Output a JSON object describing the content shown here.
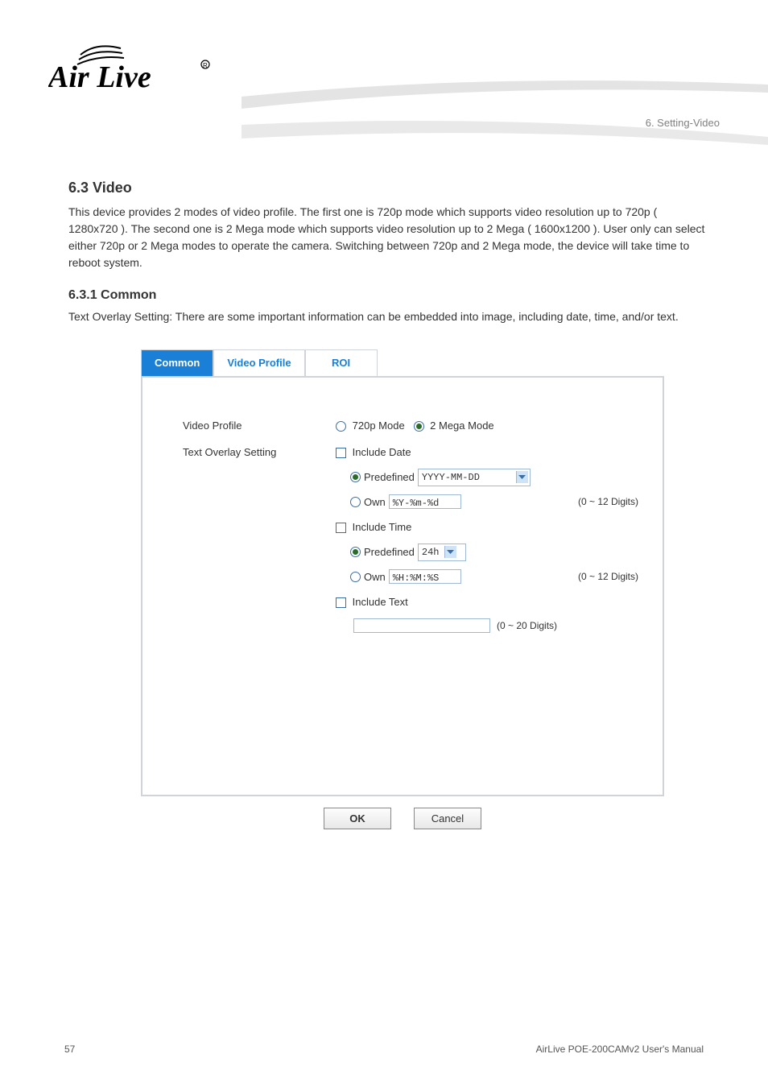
{
  "brand": "Air Live",
  "chapter_header": "6. Setting-Video",
  "section": {
    "number_title": "6.3 Video",
    "intro": "This device provides 2 modes of video profile. The first one is 720p mode which supports video resolution up to 720p ( 1280x720 ). The second one is 2 Mega mode which supports video resolution up to 2 Mega ( 1600x1200 ). User only can select either 720p or 2 Mega modes to operate the camera. Switching between 720p and 2 Mega mode, the device will take time to reboot system.",
    "common_title": "6.3.1 Common",
    "common_text": "Text Overlay Setting: There are some important information can be embedded into image, including date, time, and/or text."
  },
  "tabs": {
    "t0": "Common",
    "t1": "Video Profile",
    "t2": "ROI"
  },
  "form": {
    "video_profile_label": "Video Profile",
    "mode_720p": "720p Mode",
    "mode_2mega": "2 Mega Mode",
    "text_overlay_label": "Text Overlay Setting",
    "include_date": "Include Date",
    "predefined": "Predefined",
    "date_predef_value": "YYYY-MM-DD",
    "own": "Own",
    "date_own_value": "%Y-%m-%d",
    "hint_12": "(0 ~ 12 Digits)",
    "include_time": "Include Time",
    "time_predef_value": "24h",
    "time_own_value": "%H:%M:%S",
    "include_text": "Include Text",
    "hint_20": "(0 ~ 20 Digits)"
  },
  "buttons": {
    "ok": "OK",
    "cancel": "Cancel"
  },
  "footer": {
    "page": "57",
    "manual": "AirLive POE-200CAMv2 User's Manual"
  }
}
